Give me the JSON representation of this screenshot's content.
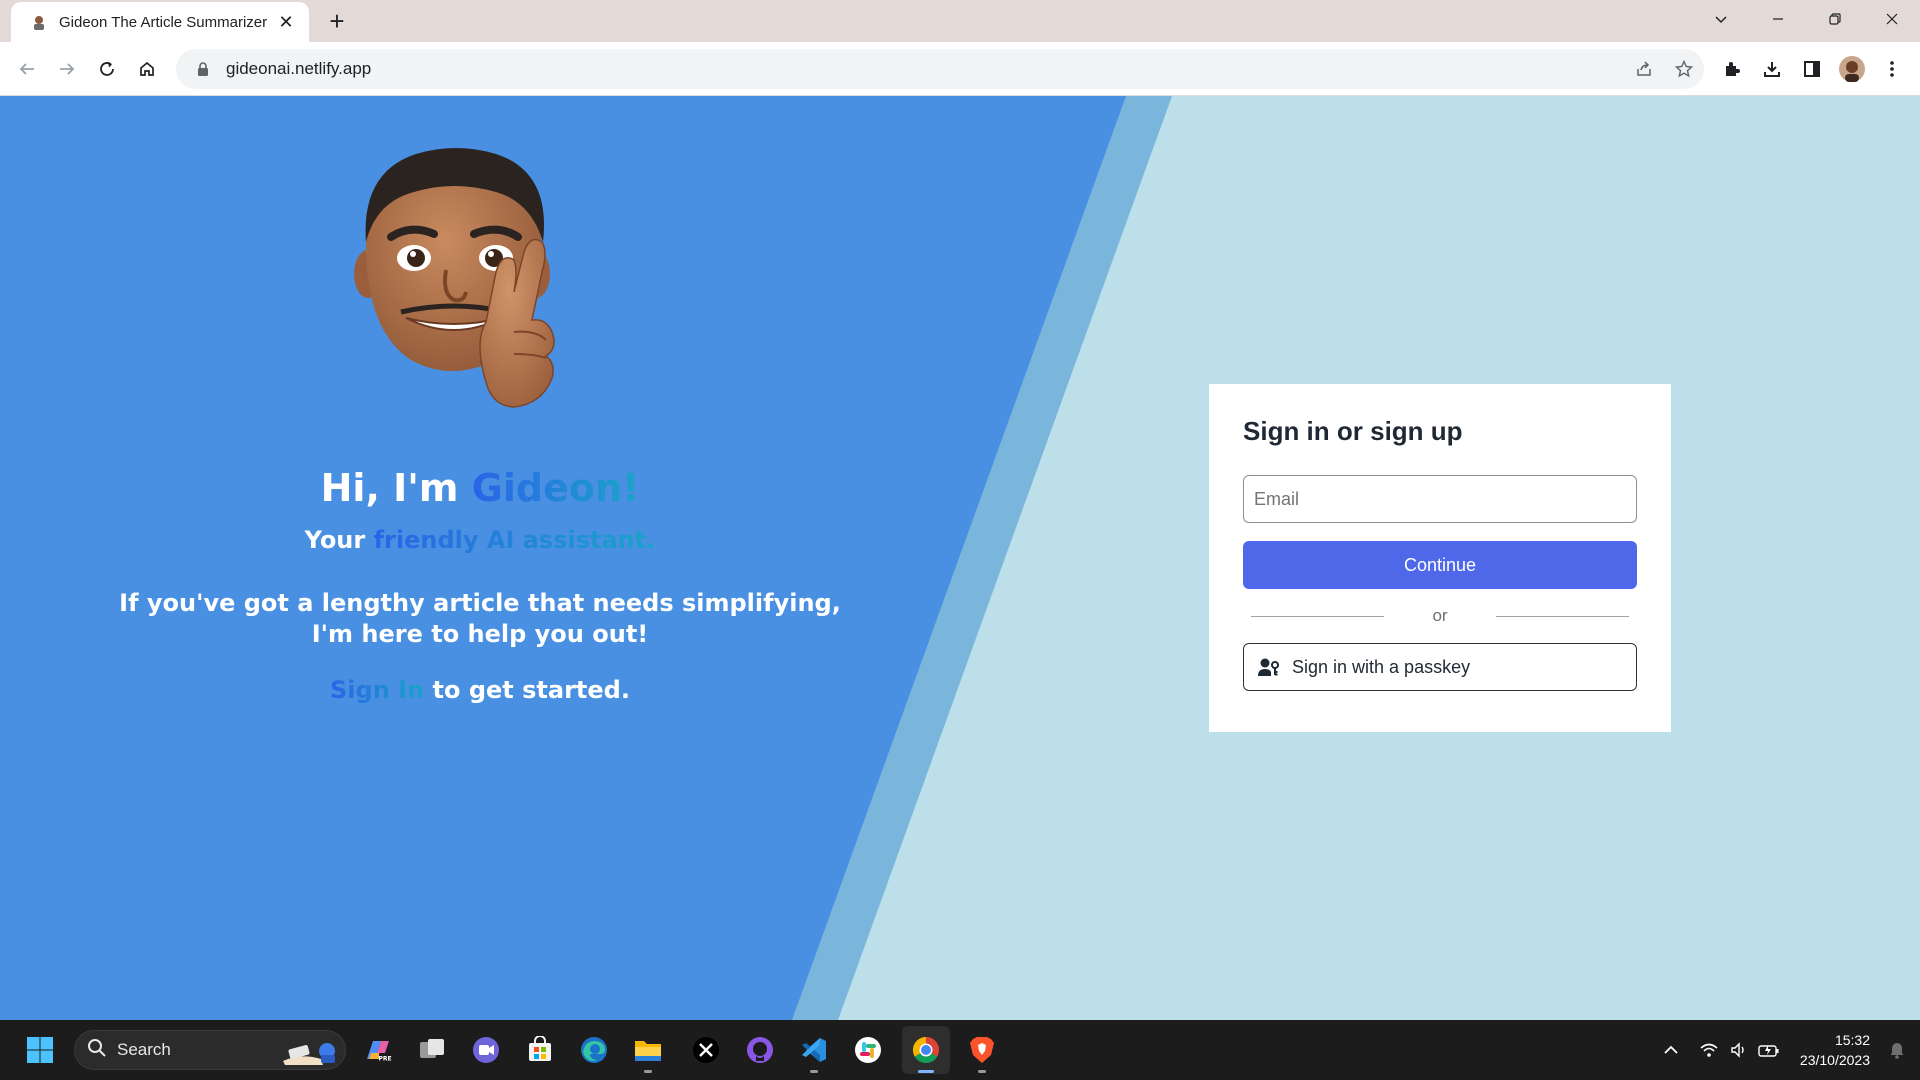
{
  "browser": {
    "tab_title": "Gideon The Article Summarizer",
    "url": "gideonai.netlify.app"
  },
  "hero": {
    "hi_prefix": "Hi, I'm ",
    "hi_name": "Gideon!",
    "your_prefix": "Your ",
    "your_highlight": "friendly AI assistant.",
    "lengthy_line1": "If you've got a lengthy article that needs simplifying,",
    "lengthy_line2": "I'm here to help you out!",
    "signin_link": "Sign In",
    "signin_suffix": " to get started."
  },
  "auth": {
    "heading": "Sign in or sign up",
    "email_placeholder": "Email",
    "continue_label": "Continue",
    "or_label": "or",
    "passkey_label": "Sign in with a passkey"
  },
  "taskbar": {
    "search_label": "Search",
    "time": "15:32",
    "date": "23/10/2023",
    "apps": [
      "copilot-icon",
      "task-view-icon",
      "teams-chat-icon",
      "store-icon",
      "edge-icon",
      "file-explorer-icon",
      "x-icon",
      "github-icon",
      "vscode-icon",
      "slack-icon",
      "chrome-icon",
      "brave-icon"
    ]
  },
  "colors": {
    "hero_blue": "#4a90e2",
    "stripe_blue": "#7ab6dc",
    "right_bg": "#bcdfe9",
    "continue_button": "#4f68ea"
  }
}
